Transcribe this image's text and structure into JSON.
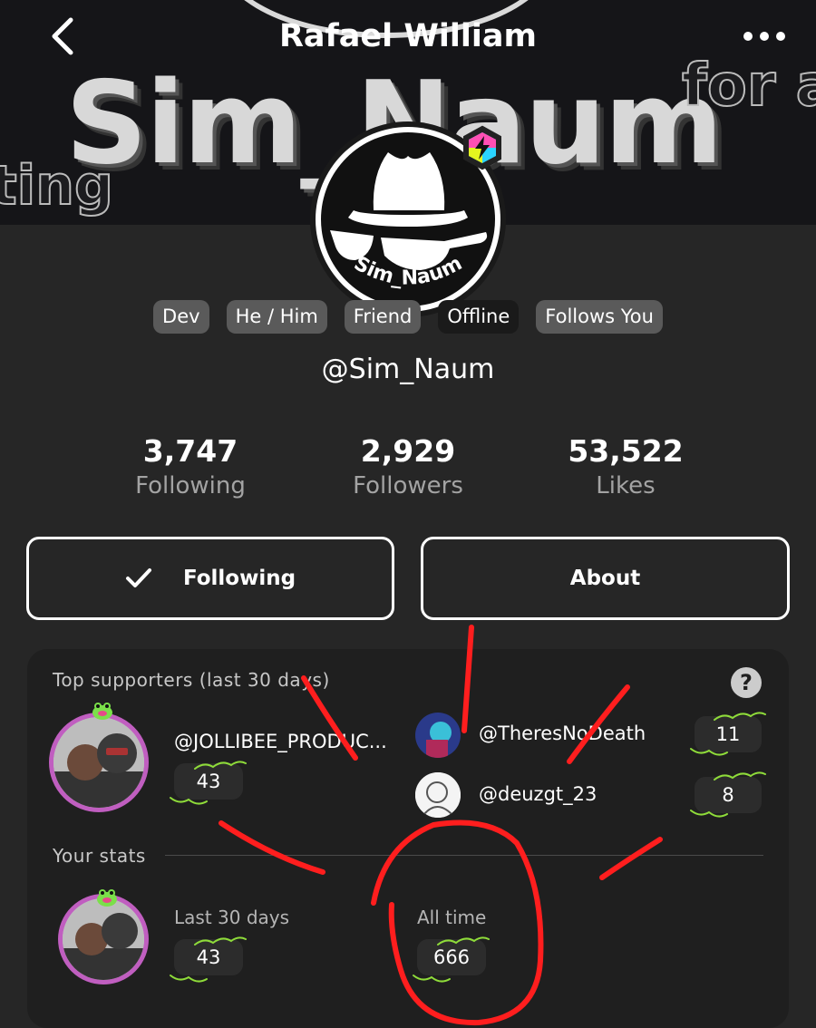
{
  "header": {
    "title": "Rafael William",
    "back_icon": "chevron-left-icon",
    "more_icon": "ellipsis-icon"
  },
  "banner": {
    "main_text": "Sim_Naum",
    "left_text": "ting",
    "right_text": "for a"
  },
  "avatar": {
    "label": "Sim_Naum",
    "badge": "lightning-badge-icon"
  },
  "tags": [
    "Dev",
    "He / Him",
    "Friend",
    "Offline",
    "Follows You"
  ],
  "handle": "@Sim_Naum",
  "stats": [
    {
      "value": "3,747",
      "label": "Following"
    },
    {
      "value": "2,929",
      "label": "Followers"
    },
    {
      "value": "53,522",
      "label": "Likes"
    }
  ],
  "actions": {
    "following_label": "Following",
    "about_label": "About"
  },
  "supporters": {
    "title": "Top supporters (last 30 days)",
    "help_icon": "?",
    "top": {
      "name": "@JOLLIBEE_PRODUC...",
      "count": "43"
    },
    "others": [
      {
        "name": "@TheresNoDeath",
        "count": "11"
      },
      {
        "name": "@deuzgt_23",
        "count": "8"
      }
    ]
  },
  "your_stats": {
    "title": "Your stats",
    "last30_label": "Last 30 days",
    "last30_value": "43",
    "alltime_label": "All time",
    "alltime_value": "666"
  },
  "colors": {
    "background": "#262626",
    "card": "#1f1f1f",
    "supporter_ring": "#c05ec0",
    "annotation": "#ff1e1e",
    "sparkle": "#8fdc3a"
  }
}
